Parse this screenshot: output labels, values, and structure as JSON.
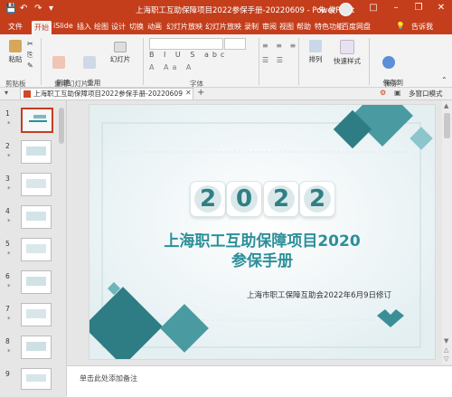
{
  "titlebar": {
    "title": "上海职工互助保障项目2022参保手册-20220609  -  PowerPoint",
    "user": "朱 俊",
    "window_controls": [
      "minimize-icon",
      "restore-icon",
      "close-icon"
    ]
  },
  "tabs": [
    "文件",
    "开始",
    "iSlide",
    "插入",
    "绘图",
    "设计",
    "切换",
    "动画",
    "幻灯片放映",
    "幻灯片放映",
    "录制",
    "审阅",
    "视图",
    "帮助",
    "特色功能",
    "百度网盘"
  ],
  "tell_me": "告诉我",
  "ribbon": {
    "paste": "粘贴",
    "new_slide": "新建\n幻灯片",
    "reuse_slide": "重用\n幻灯片",
    "slides_label": "幻灯片",
    "arrange": "排列",
    "quick_styles": "快速样式",
    "save_to_baidu": "保存到\n百度网盘",
    "groups": [
      "剪贴板",
      "重用幻灯片",
      "字体",
      "保存"
    ]
  },
  "doc_tab": {
    "name": "上海职工互助保障项目2022参保手册-20220609",
    "view_mode": "多窗口模式"
  },
  "thumbnails": [
    {
      "num": "1",
      "active": true
    },
    {
      "num": "2",
      "active": false
    },
    {
      "num": "3",
      "active": false
    },
    {
      "num": "4",
      "active": false
    },
    {
      "num": "5",
      "active": false
    },
    {
      "num": "6",
      "active": false
    },
    {
      "num": "7",
      "active": false
    },
    {
      "num": "8",
      "active": false
    },
    {
      "num": "9",
      "active": false
    }
  ],
  "slide": {
    "year_digits": [
      "2",
      "0",
      "2",
      "2"
    ],
    "title_line1": "上海职工互助保障项目2020",
    "title_line2": "参保手册",
    "org_date": "上海市职工保障互助会2022年6月9日修订",
    "accent_color": "#2d8f99"
  },
  "notes": {
    "placeholder": "单击此处添加备注"
  }
}
